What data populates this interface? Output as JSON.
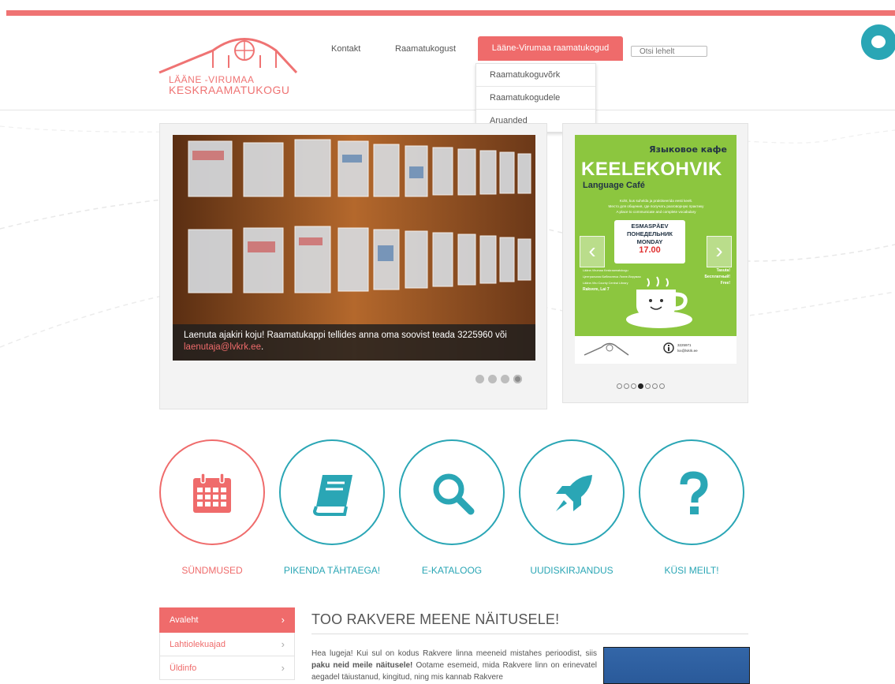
{
  "logo": {
    "line1": "LÄÄNE -VIRUMAA",
    "line2": "KESKRAAMATUKOGU"
  },
  "nav": {
    "items": [
      "Kontakt",
      "Raamatukogust"
    ],
    "active": "Lääne-Virumaa raamatukogud",
    "search_placeholder": "Otsi lehelt"
  },
  "dropdown": [
    "Raamatukoguvõrk",
    "Raamatukogudele",
    "Aruanded"
  ],
  "slider_main": {
    "caption": "Laenuta ajakiri koju! Raamatukappi tellides anna oma soovist teada 3225960 või",
    "caption_link": "laenutaja@lvkrk.ee",
    "caption_end": "."
  },
  "poster": {
    "ru_title": "Языковое кафе",
    "title": "KEELEKOHVIK",
    "subtitle": "Language Café",
    "line1": "Koht, kus suhelda ja praktiseerida eesti keelt.",
    "line2": "Место для общения, где получать разговорную практику",
    "line3": "A place to communicate and complete vocabulary",
    "day_et": "ESMASPÄEV",
    "day_ru": "ПОНЕДЕЛЬНИК",
    "day_en": "MONDAY",
    "time": "17.00",
    "left1": "Lääne-Virumaa Keskraamatukogu",
    "left2": "Центральная Библиотека Ляэне-Вирумаа",
    "left3": "Lääne-Viru County Central Library",
    "address": "Rakvere, Lai 7",
    "free1": "Tasuta!",
    "free2": "Бесплатный!",
    "free3": "Free!",
    "phone": "3225971",
    "email": "lvx@lvkrk.ee"
  },
  "circles": [
    {
      "label": "SÜNDMUSED"
    },
    {
      "label": "PIKENDA TÄHTAEGA!"
    },
    {
      "label": "E-KATALOOG"
    },
    {
      "label": "UUDISKIRJANDUS"
    },
    {
      "label": "KÜSI MEILT!"
    }
  ],
  "sidemenu": [
    "Avaleht",
    "Lahtiolekuajad",
    "Üldinfo"
  ],
  "article": {
    "title": "TOO RAKVERE MEENE NÄITUSELE!",
    "p1": "Hea lugeja! Kui sul on kodus Rakvere linna meeneid mistahes perioodist, siis ",
    "p1_bold": "paku neid meile näitusele!",
    "p2": " Ootame esemeid, mida Rakvere linn on erinevatel aegadel täiustanud, kingitud, ning mis kannab Rakvere"
  },
  "colors": {
    "accent": "#ef6b6b",
    "teal": "#2aa6b5"
  }
}
